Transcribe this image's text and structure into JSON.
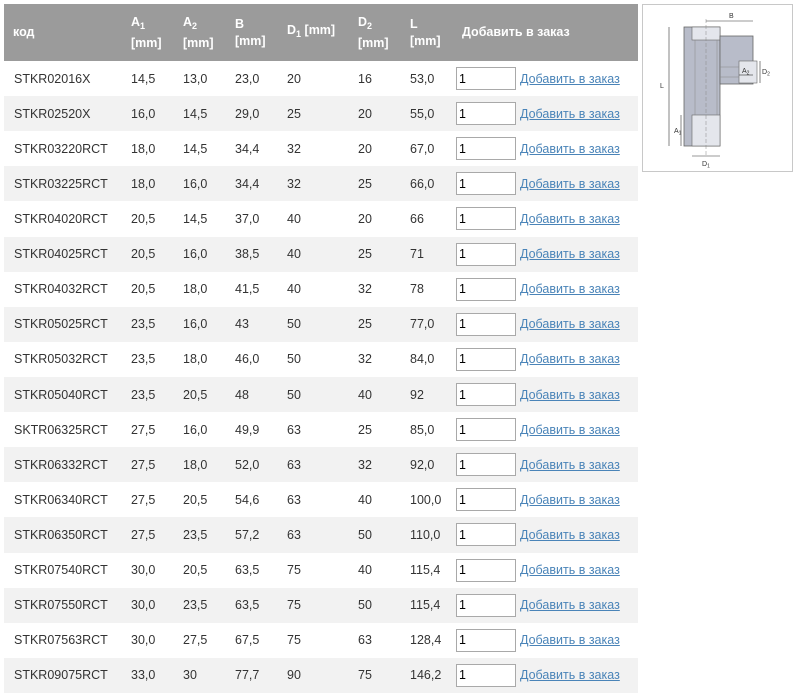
{
  "table": {
    "headers": {
      "code": "код",
      "a1_main": "A",
      "a1_sub": "1",
      "a1_unit": "[mm]",
      "a2_main": "A",
      "a2_sub": "2",
      "a2_unit": "[mm]",
      "b_main": "B",
      "b_unit": "[mm]",
      "d1_main": "D",
      "d1_sub": "1",
      "d1_unit": "[mm]",
      "d2_main": "D",
      "d2_sub": "2",
      "d2_unit": "[mm]",
      "l_main": "L",
      "l_unit": "[mm]",
      "order": "Добавить в заказ"
    },
    "add_label": "Добавить в заказ",
    "rows": [
      {
        "code": "STKR02016X",
        "a1": "14,5",
        "a2": "13,0",
        "b": "23,0",
        "d1": "20",
        "d2": "16",
        "l": "53,0",
        "qty": "1"
      },
      {
        "code": "STKR02520X",
        "a1": "16,0",
        "a2": "14,5",
        "b": "29,0",
        "d1": "25",
        "d2": "20",
        "l": "55,0",
        "qty": "1"
      },
      {
        "code": "STKR03220RCT",
        "a1": "18,0",
        "a2": "14,5",
        "b": "34,4",
        "d1": "32",
        "d2": "20",
        "l": "67,0",
        "qty": "1"
      },
      {
        "code": "STKR03225RCT",
        "a1": "18,0",
        "a2": "16,0",
        "b": "34,4",
        "d1": "32",
        "d2": "25",
        "l": "66,0",
        "qty": "1"
      },
      {
        "code": "STKR04020RCT",
        "a1": "20,5",
        "a2": "14,5",
        "b": "37,0",
        "d1": "40",
        "d2": "20",
        "l": "66",
        "qty": "1"
      },
      {
        "code": "STKR04025RCT",
        "a1": "20,5",
        "a2": "16,0",
        "b": "38,5",
        "d1": "40",
        "d2": "25",
        "l": "71",
        "qty": "1"
      },
      {
        "code": "STKR04032RCT",
        "a1": "20,5",
        "a2": "18,0",
        "b": "41,5",
        "d1": "40",
        "d2": "32",
        "l": "78",
        "qty": "1"
      },
      {
        "code": "STKR05025RCT",
        "a1": "23,5",
        "a2": "16,0",
        "b": "43",
        "d1": "50",
        "d2": "25",
        "l": "77,0",
        "qty": "1"
      },
      {
        "code": "STKR05032RCT",
        "a1": "23,5",
        "a2": "18,0",
        "b": "46,0",
        "d1": "50",
        "d2": "32",
        "l": "84,0",
        "qty": "1"
      },
      {
        "code": "STKR05040RCT",
        "a1": "23,5",
        "a2": "20,5",
        "b": "48",
        "d1": "50",
        "d2": "40",
        "l": "92",
        "qty": "1"
      },
      {
        "code": "SKTR06325RCT",
        "a1": "27,5",
        "a2": "16,0",
        "b": "49,9",
        "d1": "63",
        "d2": "25",
        "l": "85,0",
        "qty": "1"
      },
      {
        "code": "STKR06332RCT",
        "a1": "27,5",
        "a2": "18,0",
        "b": "52,0",
        "d1": "63",
        "d2": "32",
        "l": "92,0",
        "qty": "1"
      },
      {
        "code": "STKR06340RCT",
        "a1": "27,5",
        "a2": "20,5",
        "b": "54,6",
        "d1": "63",
        "d2": "40",
        "l": "100,0",
        "qty": "1"
      },
      {
        "code": "STKR06350RCT",
        "a1": "27,5",
        "a2": "23,5",
        "b": "57,2",
        "d1": "63",
        "d2": "50",
        "l": "110,0",
        "qty": "1"
      },
      {
        "code": "STKR07540RCT",
        "a1": "30,0",
        "a2": "20,5",
        "b": "63,5",
        "d1": "75",
        "d2": "40",
        "l": "115,4",
        "qty": "1"
      },
      {
        "code": "STKR07550RCT",
        "a1": "30,0",
        "a2": "23,5",
        "b": "63,5",
        "d1": "75",
        "d2": "50",
        "l": "115,4",
        "qty": "1"
      },
      {
        "code": "STKR07563RCT",
        "a1": "30,0",
        "a2": "27,5",
        "b": "67,5",
        "d1": "75",
        "d2": "63",
        "l": "128,4",
        "qty": "1"
      },
      {
        "code": "STKR09075RCT",
        "a1": "33,0",
        "a2": "30",
        "b": "77,7",
        "d1": "90",
        "d2": "75",
        "l": "146,2",
        "qty": "1"
      }
    ]
  },
  "diagram": {
    "labels": {
      "b": "B",
      "l": "L",
      "a1": "A",
      "a1_sub": "1",
      "a2": "A",
      "a2_sub": "2",
      "d1": "D",
      "d1_sub": "1",
      "d2": "D",
      "d2_sub": "2"
    }
  },
  "colors": {
    "header_bg": "#9b9b9b",
    "stripe": "#f2f2f2",
    "link": "#4a84b8",
    "fitting": "#b8bcc9"
  }
}
